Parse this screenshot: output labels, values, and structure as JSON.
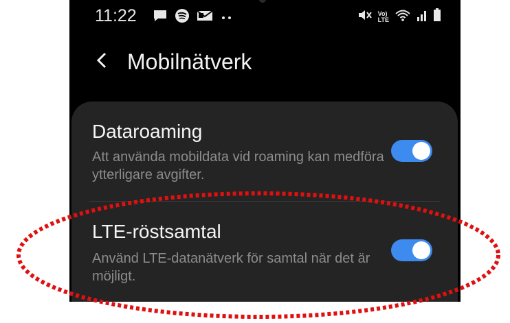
{
  "status_bar": {
    "time": "11:22",
    "left_icons": [
      "chat-bubble-icon",
      "spotify-icon",
      "message-icon",
      "more-dots-icon"
    ],
    "right_icons": [
      "mute-icon",
      "volte-icon",
      "wifi-icon",
      "signal-icon",
      "battery-icon"
    ],
    "volte_text_top": "Vo)",
    "volte_text_bottom": "LTE"
  },
  "header": {
    "back_icon": "chevron-left-icon",
    "title": "Mobilnätverk"
  },
  "settings": {
    "items": [
      {
        "title": "Dataroaming",
        "description": "Att använda mobildata vid roaming kan medföra ytterligare avgifter.",
        "enabled": true
      },
      {
        "title": "LTE-röstsamtal",
        "description": "Använd LTE-datanätverk för samtal när det är möjligt.",
        "enabled": true
      }
    ]
  },
  "colors": {
    "background": "#000000",
    "card": "#242424",
    "toggle_on": "#3e8bf0",
    "annotation": "#e01010"
  }
}
